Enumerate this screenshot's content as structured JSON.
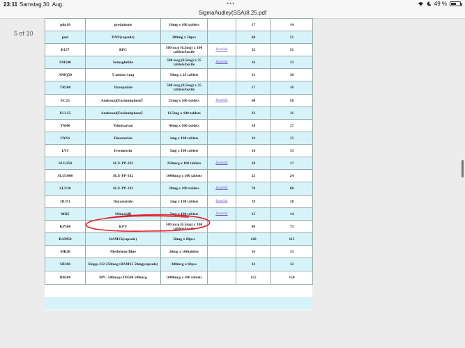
{
  "status_bar": {
    "time": "23:11",
    "date": "Samstag 30. Aug.",
    "battery": "49 %",
    "battery_level": 0.49
  },
  "document": {
    "title": "SigmaAudley(SSA)8.25.pdf",
    "page_indicator": "5 of 10"
  },
  "table": {
    "rows": [
      {
        "code": "pdn10",
        "name": "prednisone",
        "spec": "10mg x 100 tablets",
        "link": "",
        "p1": "17",
        "p2": "14"
      },
      {
        "code": "pnd",
        "name": "DNP(capsule)",
        "spec": "200mg x 50pcs",
        "link": "",
        "p1": "60",
        "p2": "51"
      },
      {
        "code": "B157",
        "name": "BPC",
        "spec": "500 mcg (0.5mg) x 100 tablets/bottle",
        "link": "Janoshik",
        "p1": "52",
        "p2": "51"
      },
      {
        "code": "SM500",
        "name": "Semaglutide",
        "spec": "500 mcg (0.5mg) x 25 tablets/bottle",
        "link": "Janoshik",
        "p1": "16",
        "p2": "15"
      },
      {
        "code": "AMQ50",
        "name": "5-amino-1mq",
        "spec": "50mg x 25 tablets",
        "link": "",
        "p1": "31",
        "p2": "30"
      },
      {
        "code": "TR500",
        "name": "Tirzepatide",
        "spec": "500 mcg (0.5mg) x 25 tablets/bottle",
        "link": "",
        "p1": "17",
        "p2": "16"
      },
      {
        "code": "EC25",
        "name": "Androxal(Enclomiphene）",
        "spec": "25mg x 100 tablets",
        "link": "Janoshik",
        "p1": "60",
        "p2": "58"
      },
      {
        "code": "EC125",
        "name": "Androxal(Enclomiphene）",
        "spec": "12.5mg x 100 tablets",
        "link": "",
        "p1": "32",
        "p2": "31"
      },
      {
        "code": "TM40",
        "name": "Telmisartan",
        "spec": "40mg x 100 tablets",
        "link": "",
        "p1": "18",
        "p2": "17"
      },
      {
        "code": "FAN1",
        "name": "Finasteride",
        "spec": "1mg x 100 tablets",
        "link": "",
        "p1": "16",
        "p2": "15"
      },
      {
        "code": "LV5",
        "name": "Ivermectin",
        "spec": "5mg x 100 tablets",
        "link": "",
        "p1": "16",
        "p2": "15"
      },
      {
        "code": "SLU250",
        "name": "SLU-PP-332",
        "spec": "250mcg x 100 tablets",
        "link": "Janoshik",
        "p1": "18",
        "p2": "17"
      },
      {
        "code": "SLU1000",
        "name": "SLU-PP-332",
        "spec": "1000mcg x 100 tablets",
        "link": "",
        "p1": "25",
        "p2": "24"
      },
      {
        "code": "SLU20",
        "name": "SLU-PP-332",
        "spec": "20mg x 100 tablets",
        "link": "Janoshik",
        "p1": "70",
        "p2": "68"
      },
      {
        "code": "DUT1",
        "name": "Dutasteride",
        "spec": "1mg x 100 tablets",
        "link": "Janoshik",
        "p1": "19",
        "p2": "18"
      },
      {
        "code": "MD5",
        "name": "Minoxidil",
        "spec": "5mg x 100 tablets",
        "link": "Janoshik",
        "p1": "15",
        "p2": "14"
      },
      {
        "code": "KP500",
        "name": "KPV",
        "spec": "500 mcg (0.5mg) x 100 tablets/bottle",
        "link": "",
        "p1": "80",
        "p2": "75"
      },
      {
        "code": "BAM50",
        "name": "BAM15(capsule)",
        "spec": "50mg x 60pcs",
        "link": "",
        "p1": "120",
        "p2": "115"
      },
      {
        "code": "MB20",
        "name": "Methylene Blue",
        "spec": "20mg x 100tablets",
        "link": "",
        "p1": "16",
        "p2": "15"
      },
      {
        "code": "SB300",
        "name": "Slupp-332 250mcg+BAM15 50mg(capsule)",
        "spec": "300mcg x 60pcs",
        "link": "",
        "p1": "33",
        "p2": "32"
      },
      {
        "code": "BB500",
        "name": "BPC 500mcg+TB500 500mcg",
        "spec": "1000mcg x 100 tablets",
        "link": "",
        "p1": "155",
        "p2": "150"
      }
    ]
  }
}
